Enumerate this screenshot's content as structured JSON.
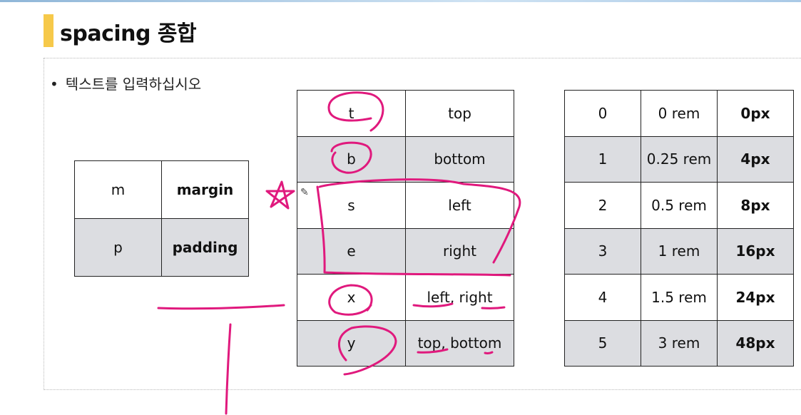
{
  "slide": {
    "title": "spacing 종합",
    "bullet": "텍스트를 입력하십시오",
    "accent_color": "#f6c94a",
    "annotation_color": "#e0197d"
  },
  "property_table": [
    {
      "abbr": "m",
      "name": "margin"
    },
    {
      "abbr": "p",
      "name": "padding"
    }
  ],
  "direction_table": [
    {
      "abbr": "t",
      "name": "top"
    },
    {
      "abbr": "b",
      "name": "bottom"
    },
    {
      "abbr": "s",
      "name": "left"
    },
    {
      "abbr": "e",
      "name": "right"
    },
    {
      "abbr": "x",
      "name": "left, right"
    },
    {
      "abbr": "y",
      "name": "top, bottom"
    }
  ],
  "size_table": [
    {
      "key": "0",
      "rem": "0 rem",
      "px": "0px"
    },
    {
      "key": "1",
      "rem": "0.25 rem",
      "px": "4px"
    },
    {
      "key": "2",
      "rem": "0.5 rem",
      "px": "8px"
    },
    {
      "key": "3",
      "rem": "1 rem",
      "px": "16px"
    },
    {
      "key": "4",
      "rem": "1.5 rem",
      "px": "24px"
    },
    {
      "key": "5",
      "rem": "3 rem",
      "px": "48px"
    }
  ]
}
